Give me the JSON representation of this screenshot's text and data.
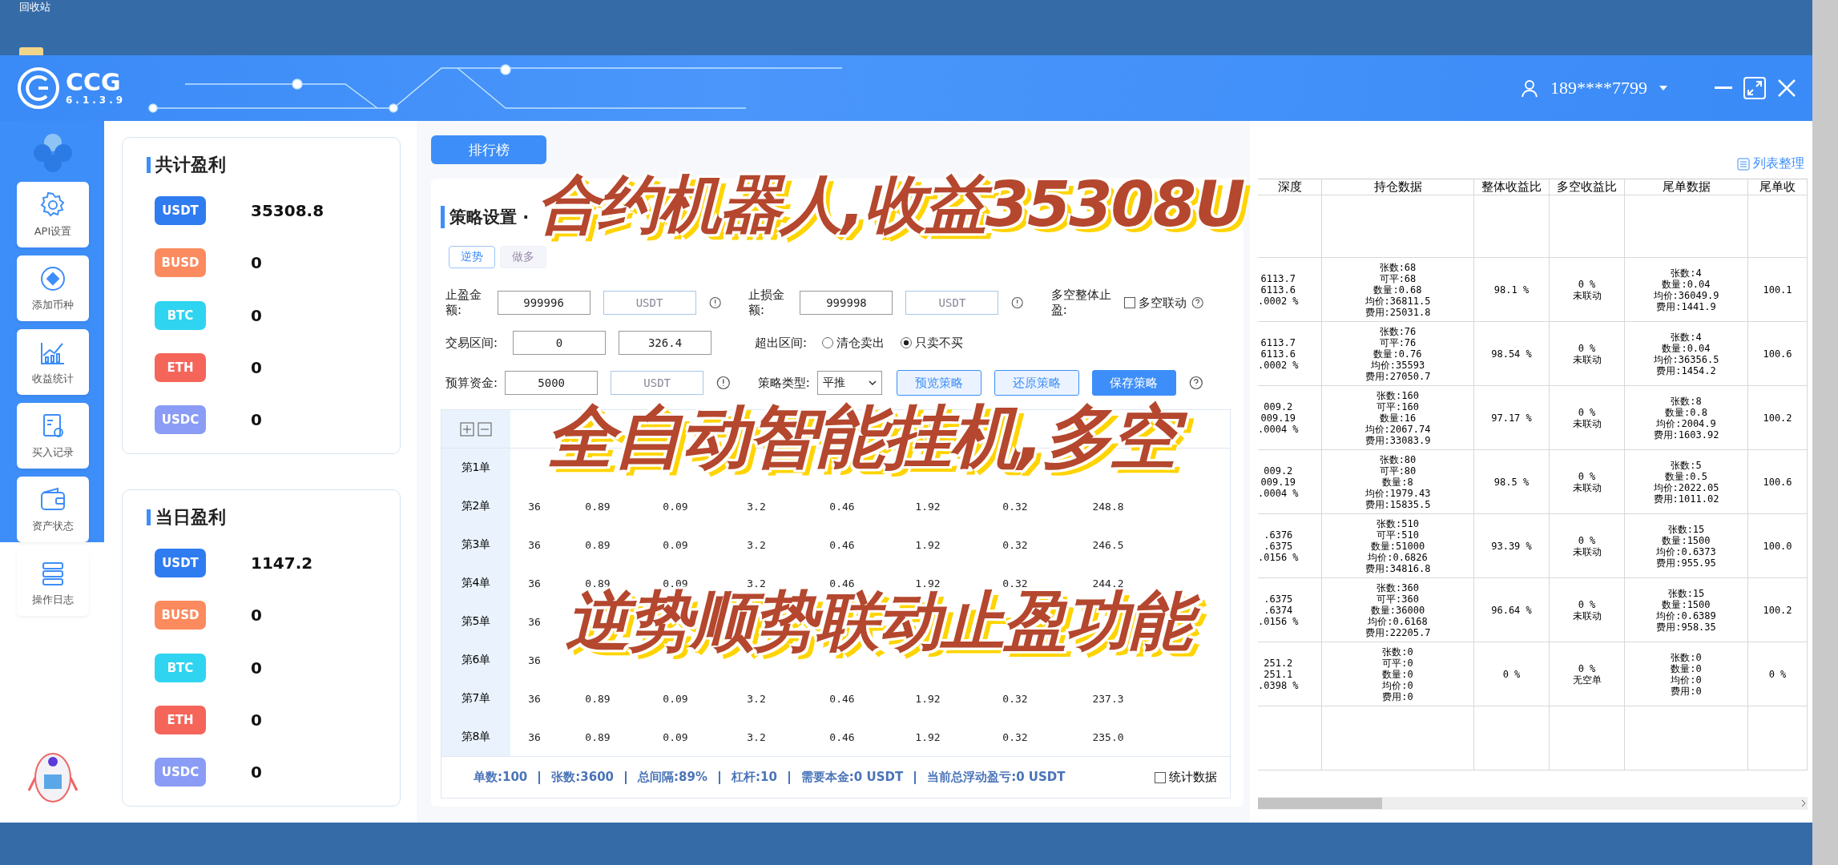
{
  "desktop": {
    "icon_label": "回收站"
  },
  "app": {
    "logo": "CCG",
    "version": "6.1.3.9",
    "user": "189****7799"
  },
  "nav": [
    {
      "label": "API设置"
    },
    {
      "label": "添加币种"
    },
    {
      "label": "收益统计"
    },
    {
      "label": "买入记录"
    },
    {
      "label": "资产状态"
    },
    {
      "label": "操作日志"
    }
  ],
  "profit_cards": [
    {
      "title": "共计盈利",
      "rows": [
        {
          "token": "USDT",
          "color": "#2f7bf0",
          "value": "35308.8"
        },
        {
          "token": "BUSD",
          "color": "#fb8b5f",
          "value": "0"
        },
        {
          "token": "BTC",
          "color": "#2fd4f0",
          "value": "0"
        },
        {
          "token": "ETH",
          "color": "#f5655a",
          "value": "0"
        },
        {
          "token": "USDC",
          "color": "#8a9cf5",
          "value": "0"
        }
      ]
    },
    {
      "title": "当日盈利",
      "rows": [
        {
          "token": "USDT",
          "color": "#2f7bf0",
          "value": "1147.2"
        },
        {
          "token": "BUSD",
          "color": "#fb8b5f",
          "value": "0"
        },
        {
          "token": "BTC",
          "color": "#2fd4f0",
          "value": "0"
        },
        {
          "token": "ETH",
          "color": "#f5655a",
          "value": "0"
        },
        {
          "token": "USDC",
          "color": "#8a9cf5",
          "value": "0"
        }
      ]
    }
  ],
  "ranking_button": "排行榜",
  "strategy": {
    "title": "策略设置 ·",
    "tabs": [
      {
        "label": "逆势",
        "selected": true
      },
      {
        "label": "做多",
        "selected": false
      }
    ],
    "take_profit": {
      "label": "止盈金额:",
      "value": "999996",
      "unit": "USDT"
    },
    "stop_loss": {
      "label": "止损金额:",
      "value": "999998",
      "unit": "USDT"
    },
    "overall": {
      "label": "多空整体止盈:",
      "checkbox": {
        "label": "多空联动",
        "checked": false
      }
    },
    "range": {
      "label": "交易区间:",
      "low": "0",
      "high": "326.4"
    },
    "out_of_range": {
      "label": "超出区间:",
      "options": [
        {
          "label": "清仓卖出",
          "selected": false
        },
        {
          "label": "只卖不买",
          "selected": true
        }
      ]
    },
    "budget": {
      "label": "预算资金:",
      "value": "5000",
      "unit": "USDT"
    },
    "type": {
      "label": "策略类型:",
      "value": "平推"
    },
    "buttons": [
      {
        "label": "预览策略",
        "kind": "outline"
      },
      {
        "label": "还原策略",
        "kind": "outline"
      },
      {
        "label": "保存策略",
        "kind": "primary"
      }
    ],
    "grid": [
      {
        "label": "第1单",
        "cells": [
          null,
          null,
          null,
          null,
          null,
          null,
          null,
          null
        ]
      },
      {
        "label": "第2单",
        "cells": [
          "36",
          "0.89",
          "0.09",
          "3.2",
          "0.46",
          "1.92",
          "0.32",
          "248.8"
        ]
      },
      {
        "label": "第3单",
        "cells": [
          "36",
          "0.89",
          "0.09",
          "3.2",
          "0.46",
          "1.92",
          "0.32",
          "246.5"
        ]
      },
      {
        "label": "第4单",
        "cells": [
          "36",
          "0.89",
          "0.09",
          "3.2",
          "0.46",
          "1.92",
          "0.32",
          "244.2"
        ]
      },
      {
        "label": "第5单",
        "cells": [
          "36",
          null,
          null,
          null,
          null,
          null,
          null,
          null
        ]
      },
      {
        "label": "第6单",
        "cells": [
          "36",
          null,
          null,
          null,
          null,
          null,
          null,
          null
        ]
      },
      {
        "label": "第7单",
        "cells": [
          "36",
          "0.89",
          "0.09",
          "3.2",
          "0.46",
          "1.92",
          "0.32",
          "237.3"
        ]
      },
      {
        "label": "第8单",
        "cells": [
          "36",
          "0.89",
          "0.09",
          "3.2",
          "0.46",
          "1.92",
          "0.32",
          "235.0"
        ]
      }
    ],
    "footer": [
      "单数:100",
      "张数:3600",
      "总间隔:89%",
      "杠杆:10",
      "需要本金:0 USDT",
      "当前总浮动盈亏:0 USDT"
    ],
    "stats_checkbox": {
      "label": "统计数据",
      "checked": false
    }
  },
  "positions": {
    "link": "列表整理",
    "columns": [
      "深度",
      "持仓数据",
      "整体收益比",
      "多空收益比",
      "尾单数据",
      "尾单收"
    ],
    "rows": [
      [
        "6113.7\n6113.6\n.0002 %",
        "张数:68\n可平:68\n数量:0.68\n均价:36811.5\n费用:25031.8",
        "98.1 %",
        "0 %\n未联动",
        "张数:4\n数量:0.04\n均价:36049.9\n费用:1441.9",
        "100.1"
      ],
      [
        "6113.7\n6113.6\n.0002 %",
        "张数:76\n可平:76\n数量:0.76\n均价:35593\n费用:27050.7",
        "98.54 %",
        "0 %\n未联动",
        "张数:4\n数量:0.04\n均价:36356.5\n费用:1454.2",
        "100.6"
      ],
      [
        "009.2\n009.19\n.0004 %",
        "张数:160\n可平:160\n数量:16\n均价:2067.74\n费用:33083.9",
        "97.17 %",
        "0 %\n未联动",
        "张数:8\n数量:0.8\n均价:2004.9\n费用:1603.92",
        "100.2"
      ],
      [
        "009.2\n009.19\n.0004 %",
        "张数:80\n可平:80\n数量:8\n均价:1979.43\n费用:15835.5",
        "98.5 %",
        "0 %\n未联动",
        "张数:5\n数量:0.5\n均价:2022.05\n费用:1011.02",
        "100.6"
      ],
      [
        ".6376\n.6375\n.0156 %",
        "张数:510\n可平:510\n数量:51000\n均价:0.6826\n费用:34816.8",
        "93.39 %",
        "0 %\n未联动",
        "张数:15\n数量:1500\n均价:0.6373\n费用:955.95",
        "100.0"
      ],
      [
        ".6375\n.6374\n.0156 %",
        "张数:360\n可平:360\n数量:36000\n均价:0.6168\n费用:22205.7",
        "96.64 %",
        "0 %\n未联动",
        "张数:15\n数量:1500\n均价:0.6389\n费用:958.35",
        "100.2"
      ],
      [
        "251.2\n251.1\n.0398 %",
        "张数:0\n可平:0\n数量:0\n均价:0\n费用:0",
        "0 %",
        "0 %\n无空单",
        "张数:0\n数量:0\n均价:0\n费用:0",
        "0 %"
      ]
    ]
  },
  "captions": [
    "合约机器人,收益35308U",
    "全自动智能挂机,多空",
    "逆势顺势联动止盈功能"
  ]
}
